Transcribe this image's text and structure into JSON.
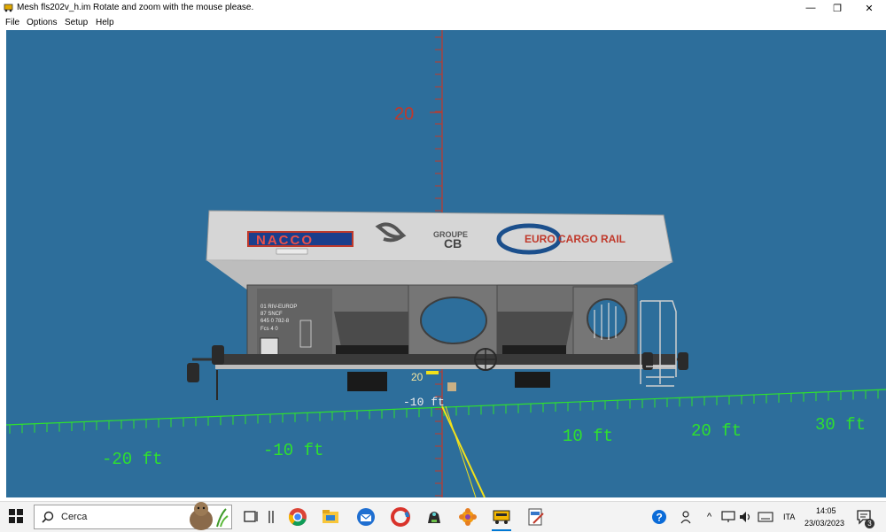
{
  "window": {
    "title": "Mesh fls202v_h.im",
    "hint": "Rotate and zoom with the mouse please.",
    "minimize_glyph": "—",
    "restore_glyph": "❐",
    "close_glyph": "✕"
  },
  "menu": [
    {
      "label": "File"
    },
    {
      "label": "Options"
    },
    {
      "label": "Setup"
    },
    {
      "label": "Help"
    }
  ],
  "scene": {
    "background": "#2d6e9b",
    "vertical_axis_color": "#c0392b",
    "ground_axis_color": "#2ee02e",
    "vertical_tick_label": "20",
    "ground_labels": [
      "-20 ft",
      "-10 ft",
      "10 ft",
      "20 ft",
      "30 ft"
    ],
    "small_labels": [
      "20",
      "-10 ft"
    ],
    "wagon": {
      "hopper_color": "#d6d6d6",
      "frame_color": "#6f6f6f",
      "logos": {
        "nacco": "NACCO",
        "groupe": "GROUPE",
        "cb": "CB",
        "ecr": "EURO CARGO RAIL"
      },
      "markings": [
        "01 RIV-EUROP",
        "87 SNCF",
        "645 0 782-8",
        "Fcs 4 0"
      ]
    }
  },
  "taskbar": {
    "search_placeholder": "Cerca",
    "lang": "ITA",
    "time": "14:05",
    "date": "23/03/2023",
    "notification_count": "3",
    "accent": "#0078d4"
  }
}
